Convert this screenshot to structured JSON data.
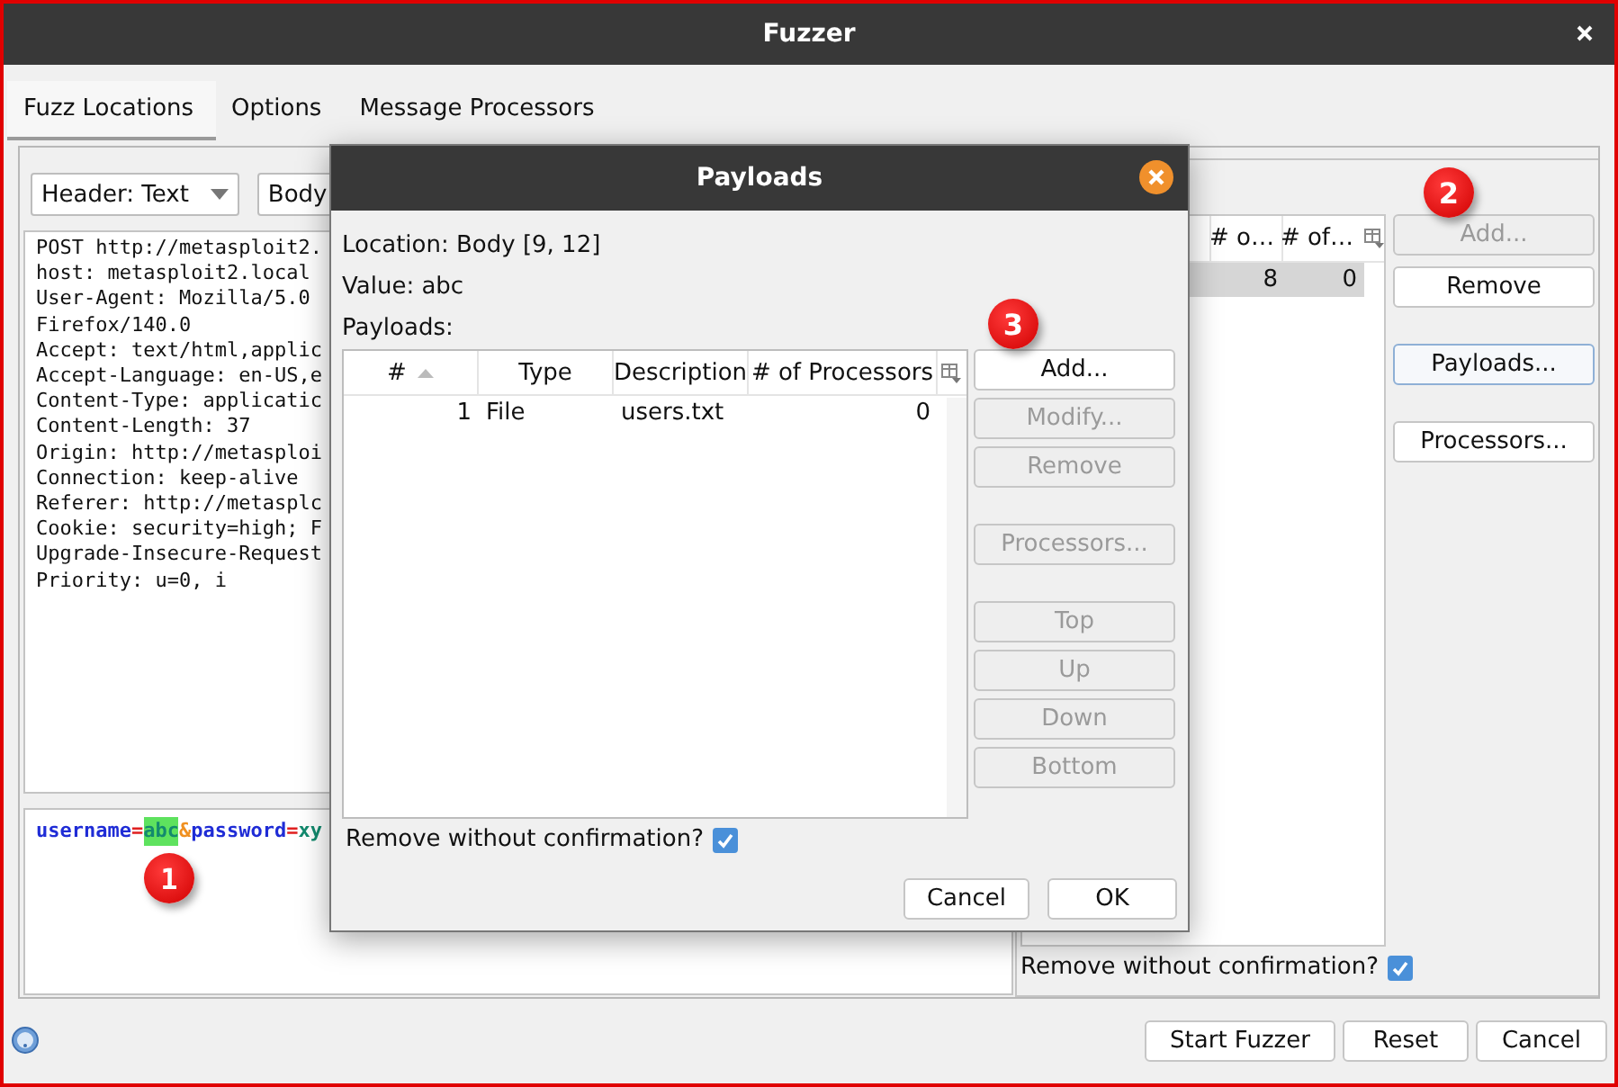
{
  "window": {
    "title": "Fuzzer"
  },
  "tabs": [
    {
      "label": "Fuzz Locations",
      "selected": true
    },
    {
      "label": "Options",
      "selected": false
    },
    {
      "label": "Message Processors",
      "selected": false
    }
  ],
  "view_selectors": [
    {
      "value": "Header: Text"
    },
    {
      "value": "Body"
    }
  ],
  "header_lines": [
    "POST http://metasploit2.",
    "host: metasploit2.local",
    "User-Agent: Mozilla/5.0",
    "Firefox/140.0",
    "Accept: text/html,applic",
    "Accept-Language: en-US,e",
    "Content-Type: applicatic",
    "Content-Length: 37",
    "Origin: http://metasploi",
    "Connection: keep-alive",
    "Referer: http://metasplc",
    "Cookie: security=high; F",
    "Upgrade-Insecure-Request",
    "Priority: u=0, i"
  ],
  "body_editor": {
    "marker": "1",
    "tokens": [
      {
        "text": "username",
        "kind": "name",
        "highlighted": false
      },
      {
        "text": "=",
        "kind": "sign",
        "highlighted": false
      },
      {
        "text": "abc",
        "kind": "value",
        "highlighted": true
      },
      {
        "text": "&",
        "kind": "amp",
        "highlighted": false
      },
      {
        "text": "password",
        "kind": "name",
        "highlighted": false
      },
      {
        "text": "=",
        "kind": "sign",
        "highlighted": false
      },
      {
        "text": "xy",
        "kind": "value",
        "highlighted": false
      }
    ]
  },
  "locations": {
    "columns": [
      "# o…",
      "# of…"
    ],
    "rows": [
      {
        "cells": [
          "8",
          "0"
        ],
        "selected": true
      }
    ],
    "marker": "2",
    "buttons": [
      {
        "label": "Add...",
        "disabled": true
      },
      {
        "label": "Remove",
        "disabled": false
      },
      {
        "label": "Payloads...",
        "disabled": false,
        "focused": true
      },
      {
        "label": "Processors...",
        "disabled": false
      }
    ],
    "remove_without_confirmation": {
      "label": "Remove without confirmation?",
      "checked": true
    }
  },
  "footer_buttons": [
    "Start Fuzzer",
    "Reset",
    "Cancel"
  ],
  "dialog": {
    "title": "Payloads",
    "location": "Location: Body [9, 12]",
    "value": "Value: abc",
    "list_label": "Payloads:",
    "marker": "3",
    "columns": [
      "#",
      "Type",
      "Description",
      "# of Processors"
    ],
    "rows": [
      {
        "cells": [
          "1",
          "File",
          "users.txt",
          "0"
        ],
        "selected": false
      }
    ],
    "buttons": [
      {
        "label": "Add...",
        "disabled": false
      },
      {
        "label": "Modify...",
        "disabled": true
      },
      {
        "label": "Remove",
        "disabled": true
      },
      {
        "label": "Processors...",
        "disabled": true
      },
      {
        "label": "Top",
        "disabled": true
      },
      {
        "label": "Up",
        "disabled": true
      },
      {
        "label": "Down",
        "disabled": true
      },
      {
        "label": "Bottom",
        "disabled": true
      }
    ],
    "remove_without_confirmation": {
      "label": "Remove without confirmation?",
      "checked": true
    },
    "actions": [
      "Cancel",
      "OK"
    ]
  }
}
